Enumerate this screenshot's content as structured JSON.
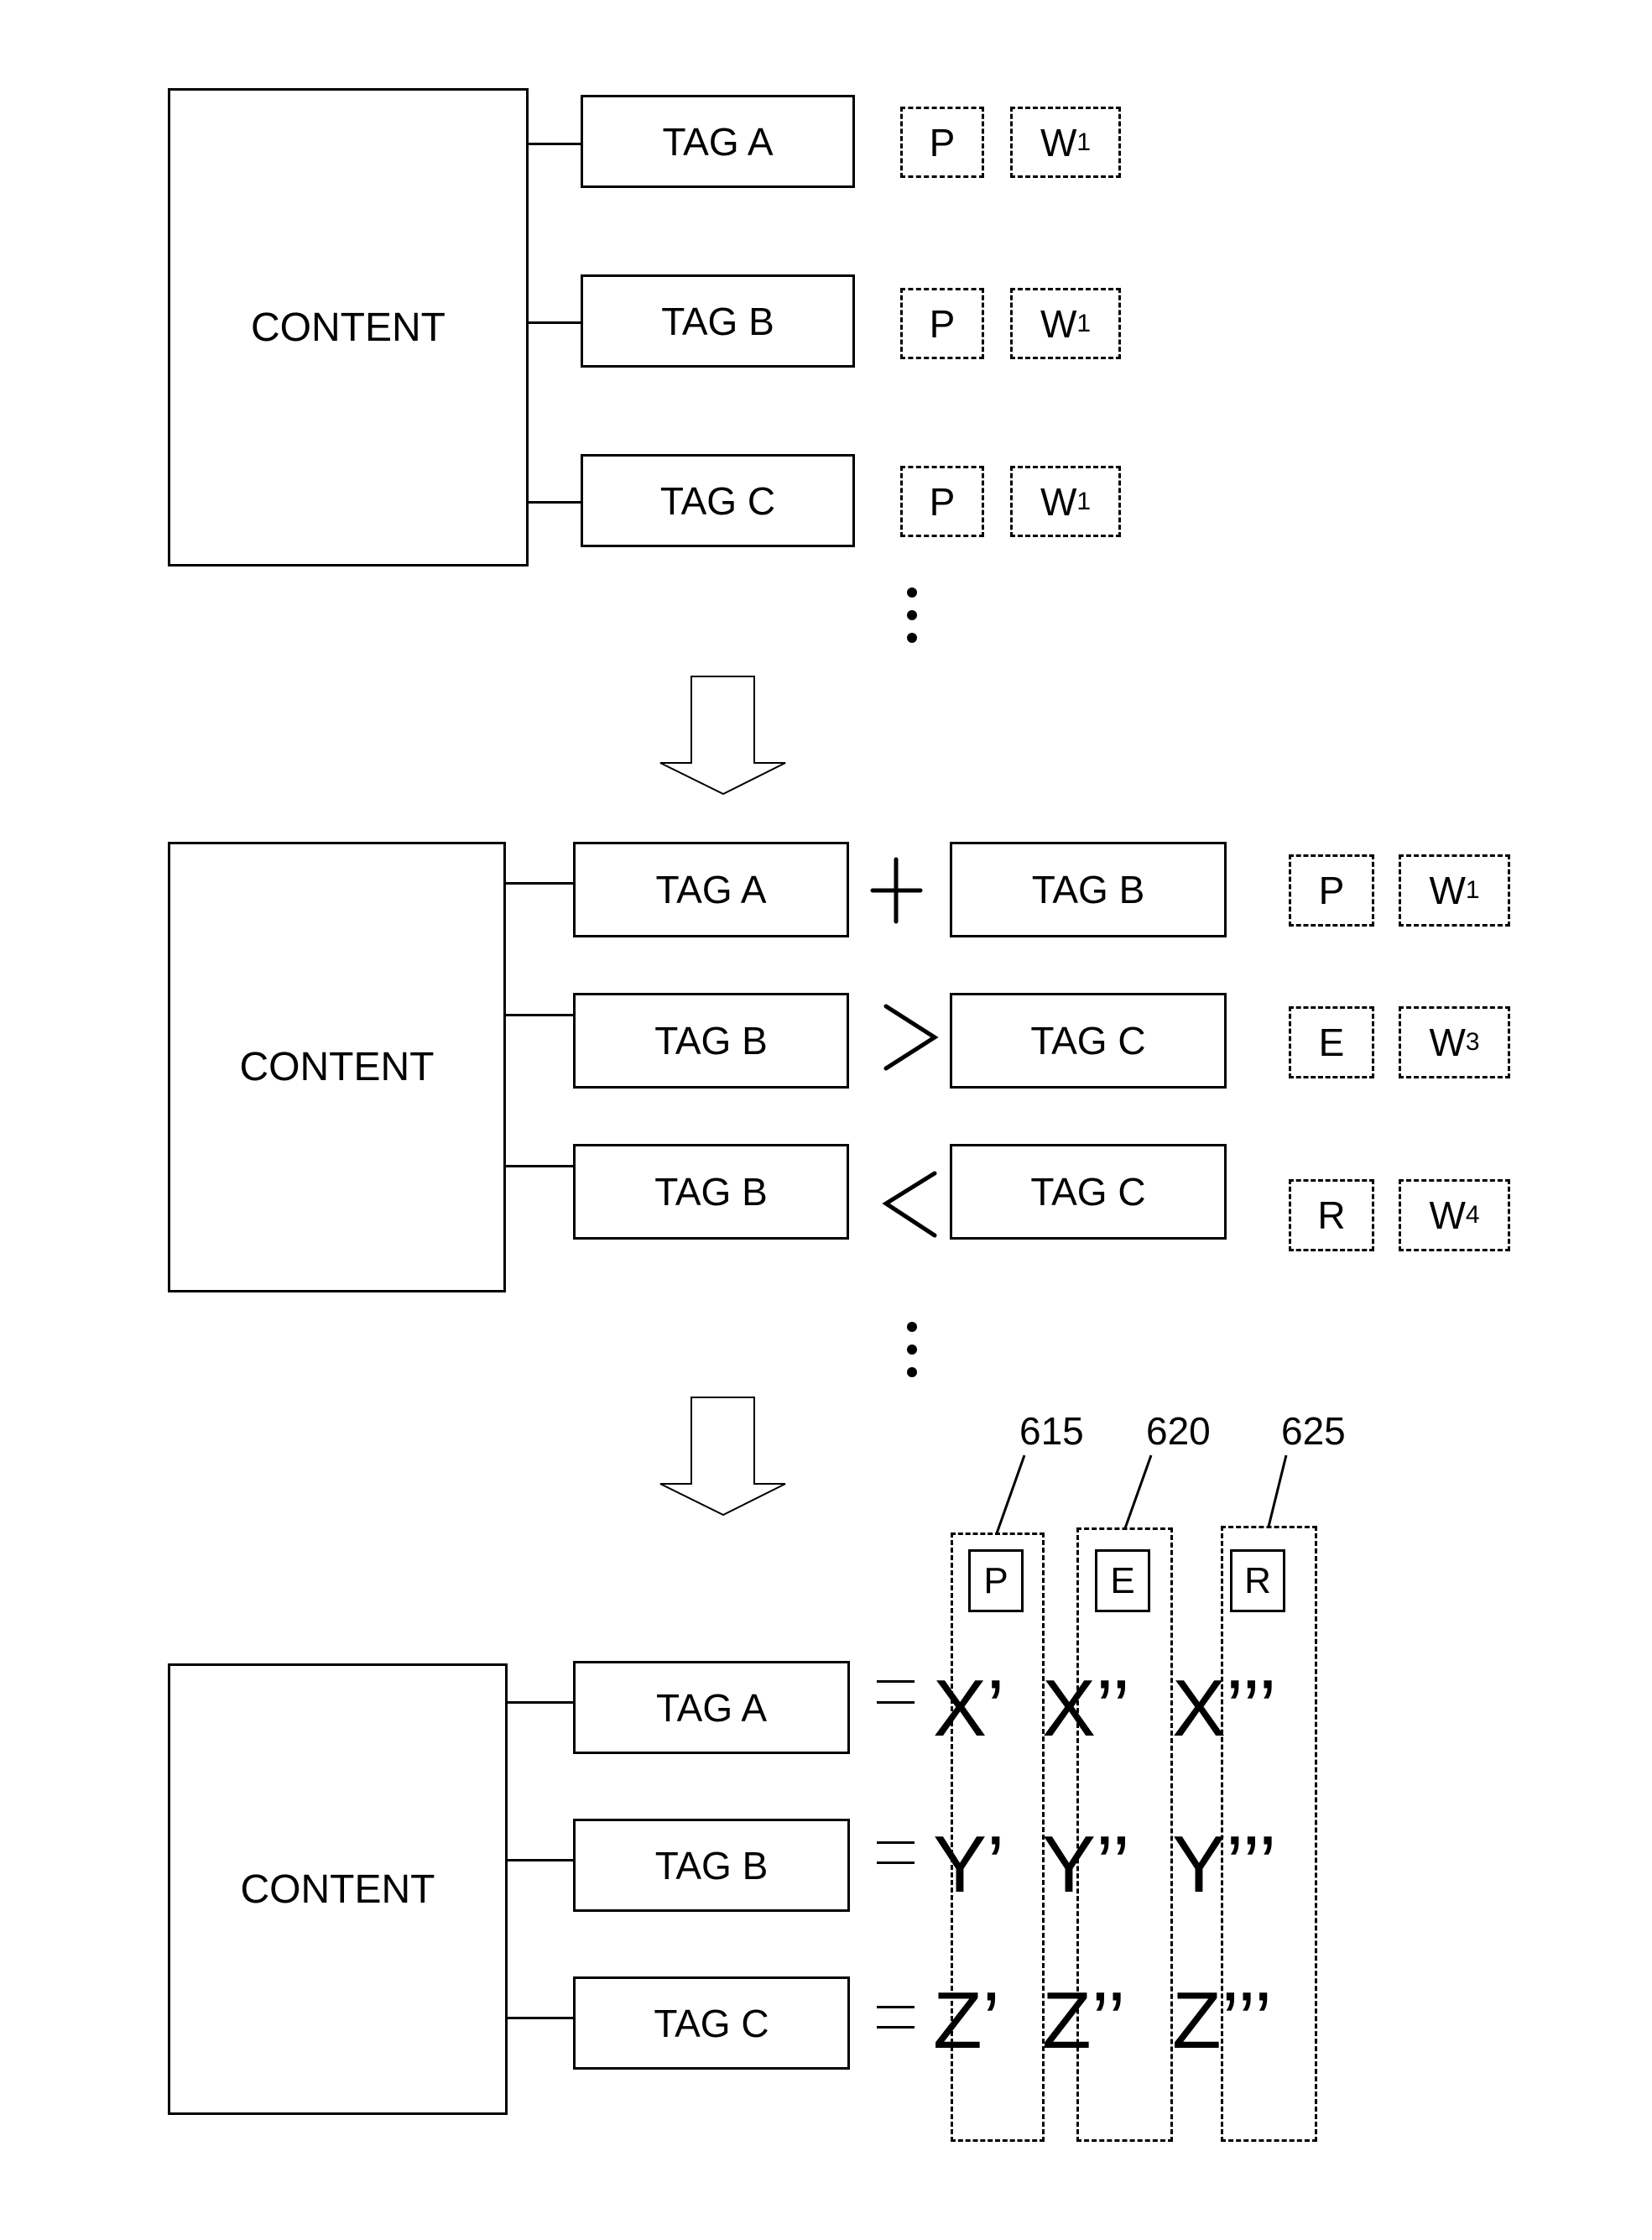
{
  "stage1": {
    "content_label": "CONTENT",
    "rows": [
      {
        "tag": "TAG A",
        "type": "P",
        "weight": "W",
        "weight_sub": "1"
      },
      {
        "tag": "TAG B",
        "type": "P",
        "weight": "W",
        "weight_sub": "1"
      },
      {
        "tag": "TAG C",
        "type": "P",
        "weight": "W",
        "weight_sub": "1"
      }
    ]
  },
  "stage2": {
    "content_label": "CONTENT",
    "rows": [
      {
        "left_tag": "TAG A",
        "operator": "+",
        "operator_icon": "plus-icon",
        "right_tag": "TAG B",
        "type": "P",
        "weight": "W",
        "weight_sub": "1"
      },
      {
        "left_tag": "TAG B",
        "operator": ">",
        "operator_icon": "greater-than-icon",
        "right_tag": "TAG C",
        "type": "E",
        "weight": "W",
        "weight_sub": "3"
      },
      {
        "left_tag": "TAG B",
        "operator": "<",
        "operator_icon": "less-than-icon",
        "right_tag": "TAG C",
        "type": "R",
        "weight": "W",
        "weight_sub": "4"
      }
    ]
  },
  "stage3": {
    "content_label": "CONTENT",
    "tags": [
      "TAG A",
      "TAG B",
      "TAG C"
    ],
    "columns": [
      {
        "ref": "615",
        "header": "P",
        "values": [
          "X’",
          "Y’",
          "Z’"
        ]
      },
      {
        "ref": "620",
        "header": "E",
        "values": [
          "X’’",
          "Y’’",
          "Z’’"
        ]
      },
      {
        "ref": "625",
        "header": "R",
        "values": [
          "X’’’",
          "Y’’’",
          "Z’’’"
        ]
      }
    ]
  },
  "icons": {
    "arrow": "down-arrow-icon",
    "ellipsis": "vertical-ellipsis-icon",
    "equals": "equals-icon"
  }
}
